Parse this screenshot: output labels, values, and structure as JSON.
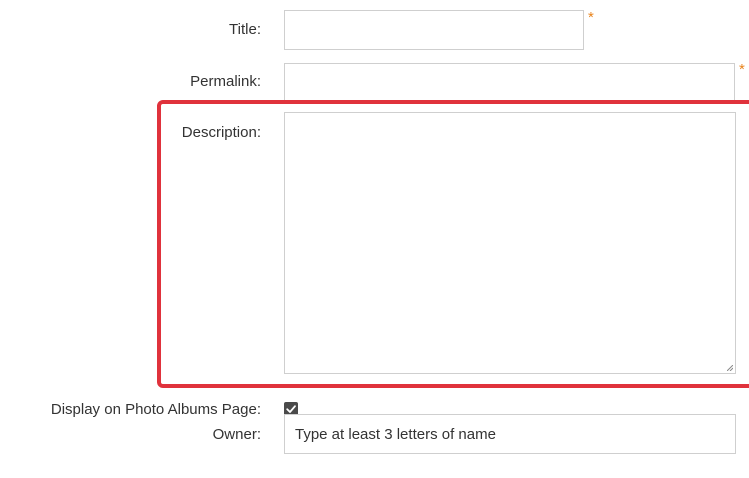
{
  "form": {
    "title": {
      "label": "Title:",
      "value": "",
      "required_marker": "*"
    },
    "permalink": {
      "label": "Permalink:",
      "value": "",
      "required_marker": "*"
    },
    "description": {
      "label": "Description:",
      "value": ""
    },
    "display_on_photo_albums": {
      "label": "Display on Photo Albums Page:",
      "checked": true
    },
    "owner": {
      "label": "Owner:",
      "placeholder": "Type at least 3 letters of name"
    }
  },
  "colors": {
    "required_marker": "#e8831c",
    "highlight_border": "#e0323c",
    "field_border": "#cfcfcf",
    "label_text": "#333333",
    "checkbox_fill": "#4a4a4a"
  }
}
